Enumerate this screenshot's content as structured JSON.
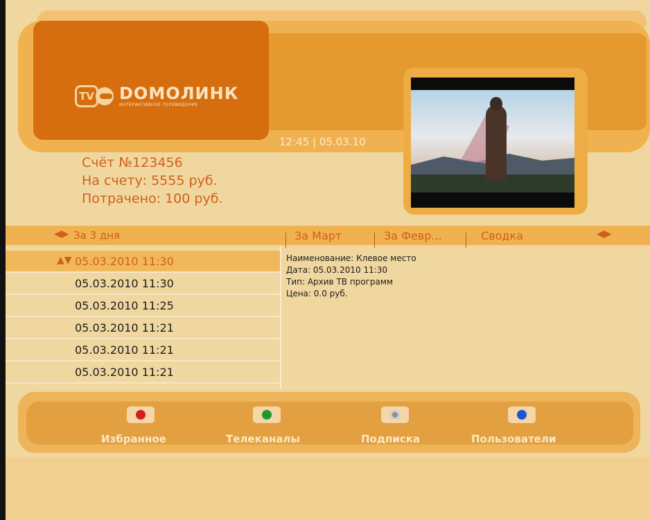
{
  "header": {
    "logo_name": "DOMOЛИНК",
    "logo_tag": "ИНТЕРАКТИВНОЕ ТЕЛЕВИДЕНИЕ",
    "clock": "12:45 | 05.03.10"
  },
  "account": {
    "number": "Счёт №123456",
    "balance": "На счету: 5555 руб.",
    "spent": "Потрачено: 100 руб."
  },
  "tabs": {
    "period_label": "За 3 дня",
    "items": [
      "За Март",
      "За Февр...",
      "Сводка"
    ]
  },
  "list": {
    "items": [
      "05.03.2010 11:30",
      "05.03.2010 11:30",
      "05.03.2010 11:25",
      "05.03.2010 11:21",
      "05.03.2010 11:21",
      "05.03.2010 11:21"
    ],
    "selected_index": 0
  },
  "details": {
    "name": "Наименование: Клевое место",
    "date": "Дата: 05.03.2010 11:30",
    "type": "Тип: Архив ТВ программ",
    "price": "Цена: 0.0 руб."
  },
  "footer_buttons": [
    {
      "label": "Избранное",
      "color": "#d51f1f"
    },
    {
      "label": "Телеканалы",
      "color": "#1e9a2c"
    },
    {
      "label": "Подписка",
      "color": "#9a9a9a"
    },
    {
      "label": "Пользователи",
      "color": "#1a56d6"
    }
  ]
}
